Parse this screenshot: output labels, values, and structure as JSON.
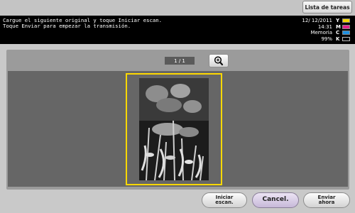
{
  "header": {
    "task_list_label": "Lista de tareas"
  },
  "message": {
    "line1": "Cargue el siguiente original y toque Iniciar escan.",
    "line2": "Toque Enviar para empezar la transmisión."
  },
  "status": {
    "date": "12/ 12/2011",
    "time": "14:31",
    "memory_label": "Memoria",
    "memory_value": "99%",
    "toner": [
      {
        "label": "Y",
        "color": "#f2d400"
      },
      {
        "label": "M",
        "color": "#e0208a"
      },
      {
        "label": "C",
        "color": "#1d8fe0"
      },
      {
        "label": "K",
        "color": "#000000"
      }
    ]
  },
  "preview": {
    "page_indicator": "1 / 1",
    "zoom_icon": "zoom-in-icon"
  },
  "footer": {
    "start_scan_line1": "Iniciar",
    "start_scan_line2": "escan.",
    "cancel_label": "Cancel.",
    "send_line1": "Enviar",
    "send_line2": "ahora"
  }
}
